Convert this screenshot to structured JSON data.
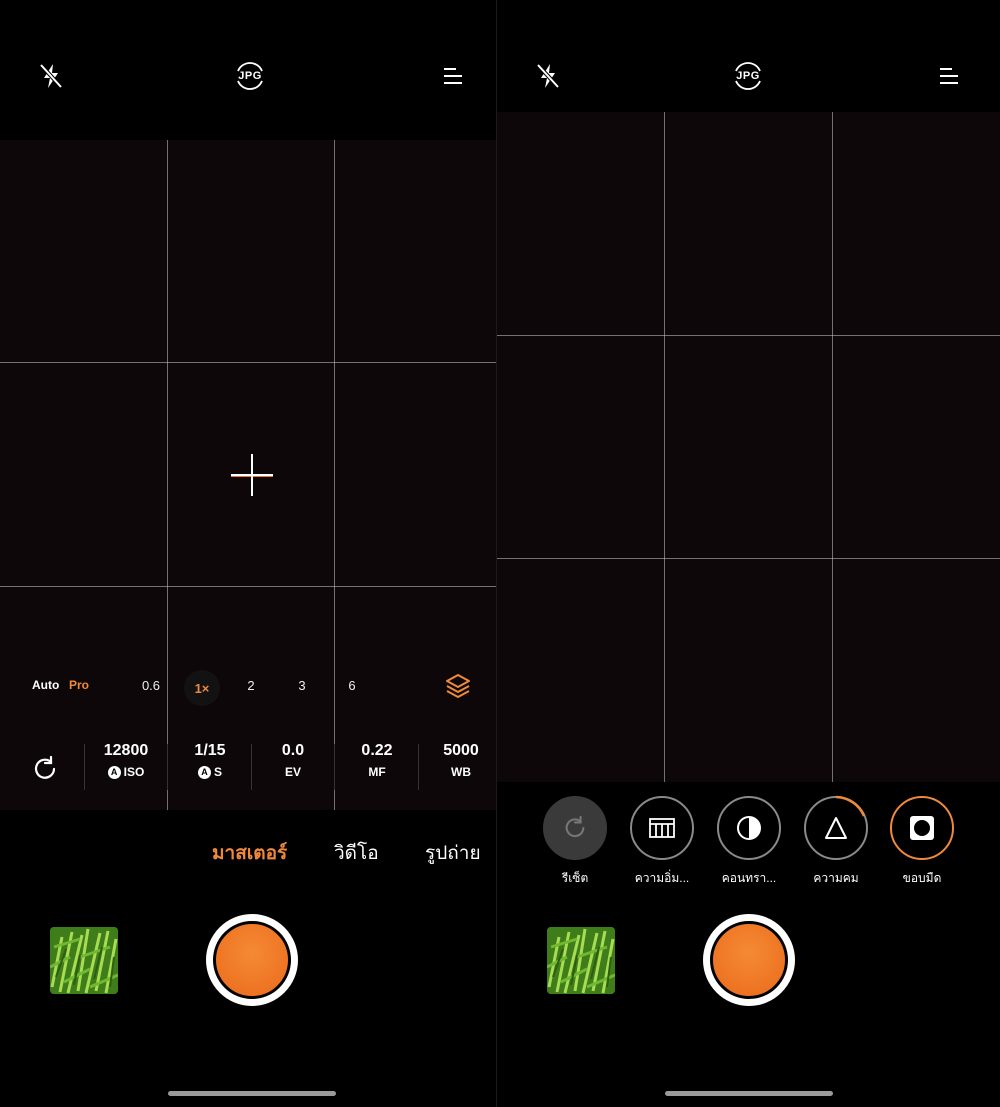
{
  "left": {
    "topbar": {
      "flash": "flash-off-icon",
      "format": "JPG",
      "menu": "menu-icon"
    },
    "zoom": {
      "auto_label": "Auto",
      "pro_label": "Pro",
      "options": [
        "0.6",
        "1×",
        "2",
        "3",
        "6"
      ],
      "active": "1×"
    },
    "params": [
      {
        "value": "12800",
        "label": "ISO",
        "auto": true
      },
      {
        "value": "1/15",
        "label": "S",
        "auto": true
      },
      {
        "value": "0.0",
        "label": "EV",
        "auto": false
      },
      {
        "value": "0.22",
        "label": "MF",
        "auto": false
      },
      {
        "value": "5000",
        "label": "WB",
        "auto": false
      }
    ],
    "auto_badge": "A",
    "modes": [
      {
        "label": "มาสเตอร์",
        "active": true
      },
      {
        "label": "วิดีโอ",
        "active": false
      },
      {
        "label": "รูปถ่าย",
        "active": false
      }
    ]
  },
  "right": {
    "topbar": {
      "flash": "flash-off-icon",
      "format": "JPG",
      "menu": "menu-icon"
    },
    "tools": [
      {
        "label": "รีเซ็ต",
        "icon": "reset-icon",
        "selected": false
      },
      {
        "label": "ความอิ่ม...",
        "icon": "saturation-icon",
        "selected": false
      },
      {
        "label": "คอนทรา...",
        "icon": "contrast-icon",
        "selected": false
      },
      {
        "label": "ความคม",
        "icon": "sharpness-icon",
        "selected": false
      },
      {
        "label": "ขอบมืด",
        "icon": "vignette-icon",
        "selected": true
      }
    ]
  },
  "colors": {
    "accent": "#f08a3a",
    "shutter": "#ef7a2a",
    "background": "#000000"
  }
}
